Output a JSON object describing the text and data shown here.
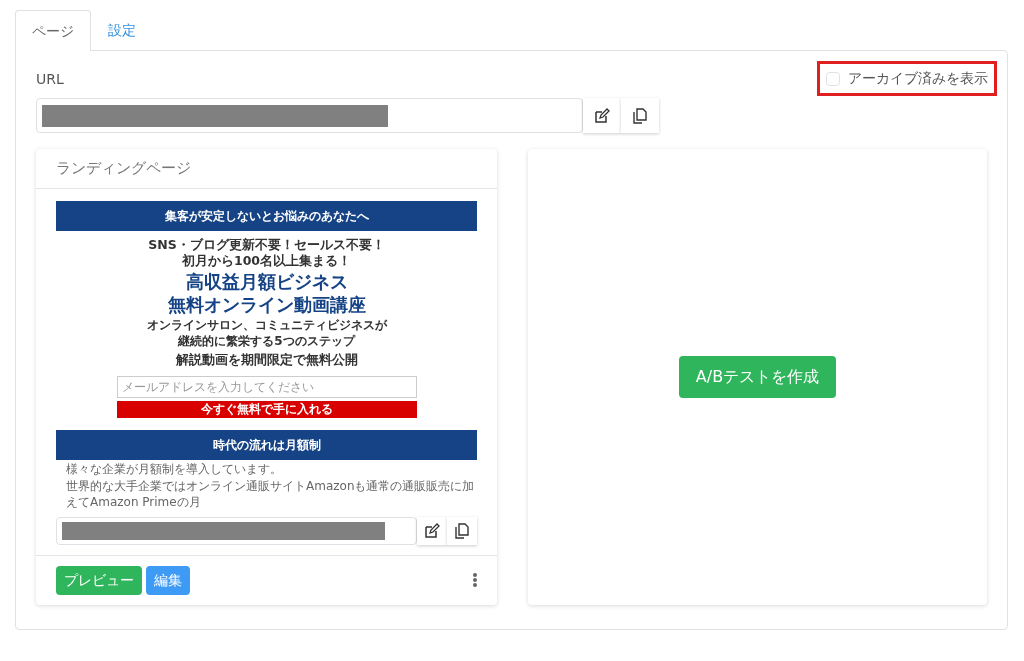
{
  "tabs": [
    {
      "label": "ページ",
      "selected": true
    },
    {
      "label": "設定",
      "selected": false
    }
  ],
  "url_label": "URL",
  "archive_toggle": {
    "label": "アーカイブ済みを表示",
    "checked": false,
    "highlighted": true
  },
  "landing_card": {
    "title": "ランディングページ",
    "preview": {
      "banner_top": "集客が安定しないとお悩みのあなたへ",
      "lead": [
        "SNS・ブログ更新不要！セールス不要！",
        "初月から100名以上集まる！"
      ],
      "headline": [
        "高収益月額ビジネス",
        "無料オンライン動画講座"
      ],
      "sub": [
        "オンラインサロン、コミュニティビジネスが",
        "継続的に繁栄する5つのステップ"
      ],
      "offer": "解説動画を期間限定で無料公開",
      "email_placeholder": "メールアドレスを入力してください",
      "cta": "今すぐ無料で手に入れる",
      "banner_mid": "時代の流れは月額制",
      "body": [
        "様々な企業が月額制を導入しています。",
        "世界的な大手企業ではオンライン通販サイトAmazonも通常の通販販売に加えてAmazon Primeの月"
      ]
    },
    "buttons": [
      {
        "label": "プレビュー",
        "kind": "success"
      },
      {
        "label": "編集",
        "kind": "primary"
      }
    ]
  },
  "ab_button": "A/Bテストを作成"
}
